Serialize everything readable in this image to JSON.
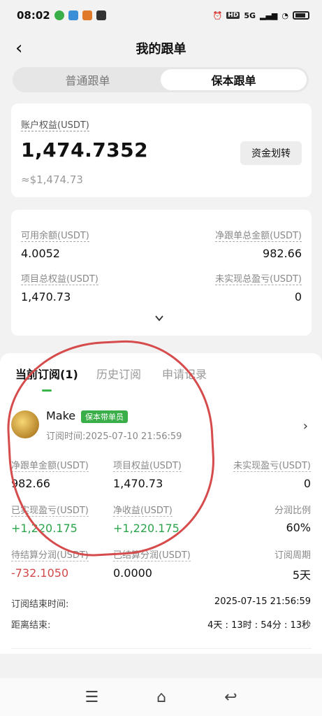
{
  "status_bar": {
    "time": "08:02",
    "network": "5G"
  },
  "header": {
    "title": "我的跟单"
  },
  "segment": {
    "tabs": [
      "普通跟单",
      "保本跟单"
    ],
    "active": 1
  },
  "equity": {
    "label": "账户权益(USDT)",
    "value": "1,474.7352",
    "approx": "≈$1,474.73",
    "transfer_label": "资金划转"
  },
  "stats": {
    "available_label": "可用余额(USDT)",
    "available_value": "4.0052",
    "net_total_label": "净跟单总金额(USDT)",
    "net_total_value": "982.66",
    "project_equity_label": "项目总权益(USDT)",
    "project_equity_value": "1,470.73",
    "unrealized_total_label": "未实现总盈亏(USDT)",
    "unrealized_total_value": "0"
  },
  "sub_tabs": [
    "当前订阅(1)",
    "历史订阅",
    "申请记录"
  ],
  "trader": {
    "name": "Make",
    "badge": "保本带单员",
    "subscribed_time": "订阅时间:2025-07-10 21:56:59"
  },
  "details": {
    "net_amount_label": "净跟单金额(USDT)",
    "net_amount_value": "982.66",
    "project_equity_label": "项目权益(USDT)",
    "project_equity_value": "1,470.73",
    "unrealized_label": "未实现盈亏(USDT)",
    "unrealized_value": "0",
    "realized_label": "已实现盈亏(USDT)",
    "realized_value": "+1,220.175",
    "net_profit_label": "净收益(USDT)",
    "net_profit_value": "+1,220.175",
    "share_ratio_label": "分润比例",
    "share_ratio_value": "60%",
    "pending_share_label": "待结算分润(USDT)",
    "pending_share_value": "-732.1050",
    "settled_share_label": "已结算分润(USDT)",
    "settled_share_value": "0.0000",
    "period_label": "订阅周期",
    "period_value": "5天"
  },
  "end": {
    "end_time_label": "订阅结束时间:",
    "end_time_value": "2025-07-15 21:56:59",
    "remaining_label": "距离结束:",
    "remaining_value": "4天 : 13时 : 54分 : 13秒"
  },
  "colors": {
    "accent_green": "#39b54a",
    "profit_green": "#2aa44a",
    "loss_red": "#d24a4a",
    "annotation_red": "#d64b4b"
  }
}
